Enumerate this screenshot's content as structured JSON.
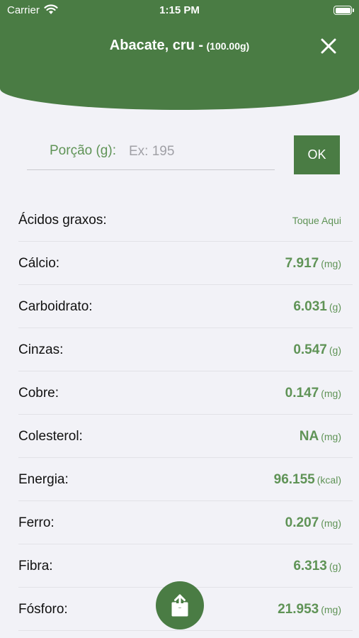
{
  "status_bar": {
    "carrier": "Carrier",
    "time": "1:15 PM"
  },
  "header": {
    "food_name": "Abacate, cru -",
    "portion_label": "(100.00g)"
  },
  "portion_input": {
    "label": "Porção (g):",
    "placeholder": "Ex: 195",
    "value": "",
    "ok_label": "OK"
  },
  "nutrients": [
    {
      "name": "Ácidos graxos:",
      "action": "Toque Aqui"
    },
    {
      "name": "Cálcio:",
      "value": "7.917",
      "unit": "(mg)"
    },
    {
      "name": "Carboidrato:",
      "value": "6.031",
      "unit": "(g)"
    },
    {
      "name": "Cinzas:",
      "value": "0.547",
      "unit": "(g)"
    },
    {
      "name": "Cobre:",
      "value": "0.147",
      "unit": "(mg)"
    },
    {
      "name": "Colesterol:",
      "value": "NA",
      "unit": "(mg)"
    },
    {
      "name": "Energia:",
      "value": "96.155",
      "unit": "(kcal)"
    },
    {
      "name": "Ferro:",
      "value": "0.207",
      "unit": "(mg)"
    },
    {
      "name": "Fibra:",
      "value": "6.313",
      "unit": "(g)"
    },
    {
      "name": "Fósforo:",
      "value": "21.953",
      "unit": "(mg)"
    }
  ],
  "icons": {
    "close": "close-icon",
    "share": "share-icon",
    "wifi": "wifi-icon",
    "battery": "battery-icon"
  },
  "colors": {
    "brand_green": "#4a7c44",
    "value_green": "#5f9356",
    "background": "#f2f2f7"
  }
}
